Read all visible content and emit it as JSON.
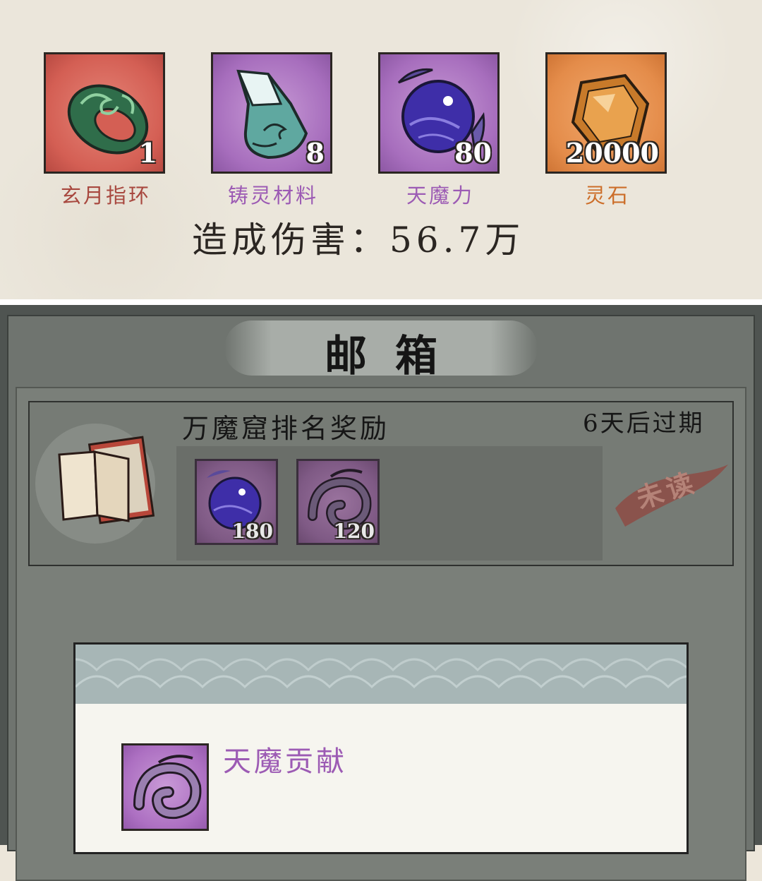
{
  "rewards": [
    {
      "name": "玄月指环",
      "qty": "1",
      "icon": "jade-ring-icon",
      "name_color": "#a8483f"
    },
    {
      "name": "铸灵材料",
      "qty": "8",
      "icon": "spirit-crystal-icon",
      "name_color": "#9c5bb4"
    },
    {
      "name": "天魔力",
      "qty": "80",
      "icon": "demon-orb-icon",
      "name_color": "#9c5bb4"
    },
    {
      "name": "灵石",
      "qty": "20000",
      "icon": "spirit-stone-icon",
      "name_color": "#cc6e2a"
    }
  ],
  "damage_text": "造成伤害：56.7万",
  "mailbox": {
    "title": "邮箱",
    "mail": {
      "subject": "万魔窟排名奖励",
      "expire": "6天后过期",
      "status": "未读",
      "attachments": [
        {
          "qty": "180",
          "icon": "demon-orb-icon"
        },
        {
          "qty": "120",
          "icon": "demon-serpent-icon"
        }
      ]
    }
  },
  "detail": {
    "name": "天魔贡献",
    "icon": "demon-serpent-icon"
  }
}
